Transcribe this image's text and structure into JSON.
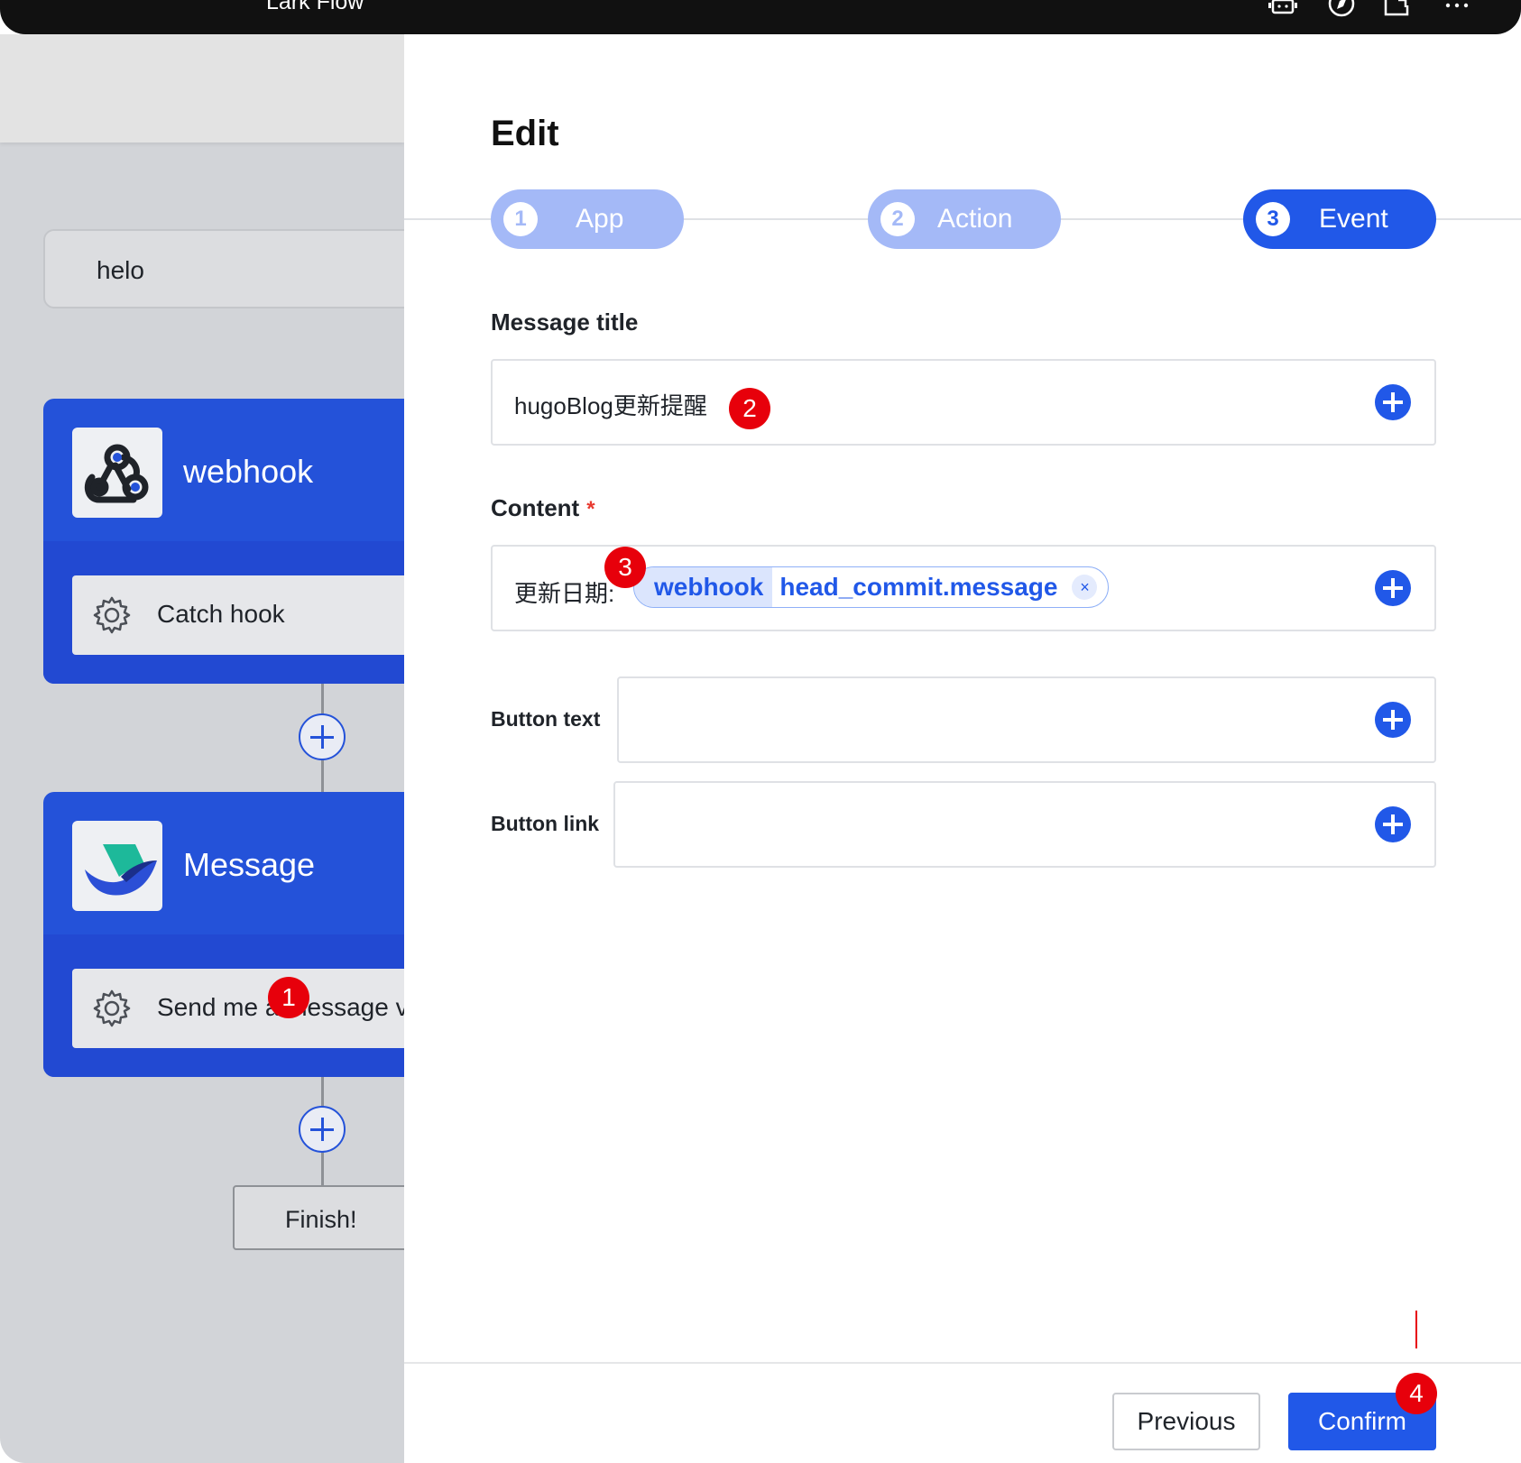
{
  "window": {
    "title": "Lark Flow"
  },
  "canvas": {
    "flow_name": "helo",
    "trigger": {
      "name": "webhook",
      "step": "Catch hook"
    },
    "action": {
      "name": "Message",
      "step": "Send me a message via"
    },
    "finish": "Finish!"
  },
  "panel": {
    "title": "Edit",
    "steps": [
      {
        "num": "1",
        "label": "App",
        "state": "done"
      },
      {
        "num": "2",
        "label": "Action",
        "state": "done"
      },
      {
        "num": "3",
        "label": "Event",
        "state": "active"
      }
    ],
    "message_title": {
      "label": "Message title",
      "value": "hugoBlog更新提醒"
    },
    "content": {
      "label": "Content",
      "required_mark": "*",
      "prefix": "更新日期:",
      "tag": {
        "source": "webhook",
        "path": "head_commit.message",
        "remove": "×"
      }
    },
    "button_text": {
      "label": "Button text",
      "value": ""
    },
    "button_link": {
      "label": "Button link",
      "value": ""
    },
    "footer": {
      "previous": "Previous",
      "confirm": "Confirm"
    }
  },
  "annotations": [
    "1",
    "2",
    "3",
    "4"
  ],
  "colors": {
    "primary": "#2158e8",
    "step_pending": "#a4b9f7",
    "card": "#2452d9",
    "badge": "#e7000b"
  }
}
